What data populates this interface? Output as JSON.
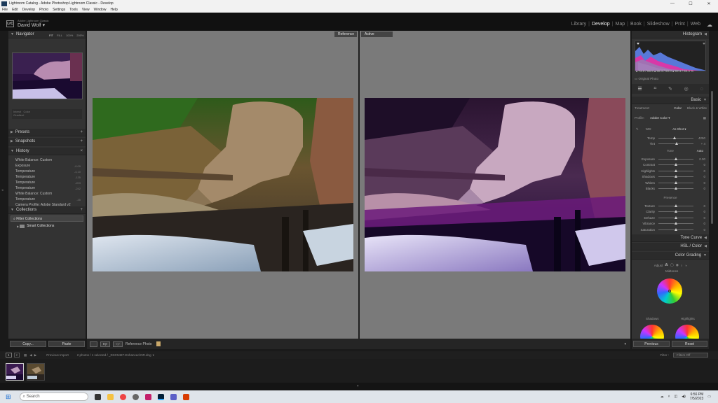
{
  "window": {
    "title": "Lightroom Catalog - Adobe Photoshop Lightroom Classic - Develop",
    "min": "—",
    "max": "☐",
    "close": "✕"
  },
  "menu": [
    "File",
    "Edit",
    "Develop",
    "Photo",
    "Settings",
    "Tools",
    "View",
    "Window",
    "Help"
  ],
  "identity": {
    "logo": "LrC",
    "subtitle": "Adobe Lightroom Classic",
    "user": "David Wolf"
  },
  "modules": [
    {
      "label": "Library",
      "active": false
    },
    {
      "label": "Develop",
      "active": true
    },
    {
      "label": "Map",
      "active": false
    },
    {
      "label": "Book",
      "active": false
    },
    {
      "label": "Slideshow",
      "active": false
    },
    {
      "label": "Print",
      "active": false
    },
    {
      "label": "Web",
      "active": false
    }
  ],
  "left": {
    "navigator": {
      "title": "Navigator",
      "fit": "FIT",
      "fill": "FILL",
      "pct": "100%",
      "zoom": "200%"
    },
    "navstrip": [
      "Interct",
      "Color"
    ],
    "navstrip2": "Gradient",
    "presets": "Presets",
    "snapshots": "Snapshots",
    "history": {
      "title": "History",
      "items": [
        {
          "label": "White Balance: Custom",
          "val": "",
          "sel": false
        },
        {
          "label": "Exposure",
          "val": "-0.09",
          "sel": false
        },
        {
          "label": "Temperature",
          "val": "-4,10",
          "sel": false
        },
        {
          "label": "Temperature",
          "val": "-135",
          "sel": false
        },
        {
          "label": "Temperature",
          "val": "-203",
          "sel": false
        },
        {
          "label": "Temperature",
          "val": "-242",
          "sel": false
        },
        {
          "label": "White Balance: Custom",
          "val": "",
          "sel": false
        },
        {
          "label": "Temperature",
          "val": "-35",
          "sel": false
        },
        {
          "label": "Camera Profile: Adobe Standard v2",
          "val": "",
          "sel": false
        },
        {
          "label": "Enhanced NR-50 (7/5/2023 6:44:06 PM)",
          "val": "",
          "sel": true
        }
      ]
    },
    "collections": {
      "title": "Collections",
      "filter": "Filter Collections",
      "smart": "Smart Collections"
    },
    "copy": "Copy...",
    "paste": "Paste"
  },
  "center": {
    "reference_label": "Reference",
    "active_label": "Active"
  },
  "toolbar": {
    "ref_label": "Reference Photo",
    "ry": "R|Y",
    "ab": "Y|Y"
  },
  "right": {
    "histogram": {
      "title": "Histogram",
      "readout": "▴  73.0 / 86.9    ▴  68.4 / 60.0    ▴  59.4 / 60.4  %",
      "original": "Original Photo"
    },
    "basic": {
      "title": "Basic",
      "treatment_label": "Treatment:",
      "color": "Color",
      "bw": "Black & White",
      "profile_label": "Profile:",
      "profile_value": "Adobe Color",
      "wb_label": "WB:",
      "wb_value": "As Shot",
      "rows_wb": [
        {
          "label": "Temp",
          "val": "4250",
          "pos": 0.45
        },
        {
          "label": "Tint",
          "val": "+ 4",
          "pos": 0.52
        }
      ],
      "tone_label": "Tone",
      "auto": "Auto",
      "rows_tone": [
        {
          "label": "Exposure",
          "val": "0.00",
          "pos": 0.5
        },
        {
          "label": "Contrast",
          "val": "0",
          "pos": 0.5
        },
        {
          "label": "Highlights",
          "val": "0",
          "pos": 0.5
        },
        {
          "label": "Shadows",
          "val": "0",
          "pos": 0.5
        },
        {
          "label": "Whites",
          "val": "0",
          "pos": 0.5
        },
        {
          "label": "Blacks",
          "val": "0",
          "pos": 0.5
        }
      ],
      "presence_label": "Presence",
      "rows_presence": [
        {
          "label": "Texture",
          "val": "0",
          "pos": 0.5
        },
        {
          "label": "Clarity",
          "val": "0",
          "pos": 0.5
        },
        {
          "label": "Dehaze",
          "val": "0",
          "pos": 0.5
        },
        {
          "label": "Vibrance",
          "val": "0",
          "pos": 0.5
        },
        {
          "label": "Saturation",
          "val": "0",
          "pos": 0.5
        }
      ]
    },
    "tonecurve": "Tone Curve",
    "hsl": "HSL / Color",
    "colorgrading": {
      "title": "Color Grading",
      "adjust": "Adjust",
      "midtones": "Midtones",
      "shadows": "Shadows",
      "highlights": "Highlights"
    },
    "previous": "Previous",
    "reset": "Reset"
  },
  "filmstrip": {
    "left": "Previous Import",
    "info": "2 photos / 1 selected / _DSC5487-Enhanced-NR.dng",
    "filter_label": "Filter :",
    "filter_value": "Filters Off",
    "page1": "1",
    "page2": "2"
  },
  "taskbar": {
    "search_placeholder": "Search",
    "time": "6:56 PM",
    "date": "7/5/2023"
  },
  "colors": {
    "accent": "#c9a86a",
    "panel": "#333333",
    "canvas": "#7a7a7a"
  }
}
